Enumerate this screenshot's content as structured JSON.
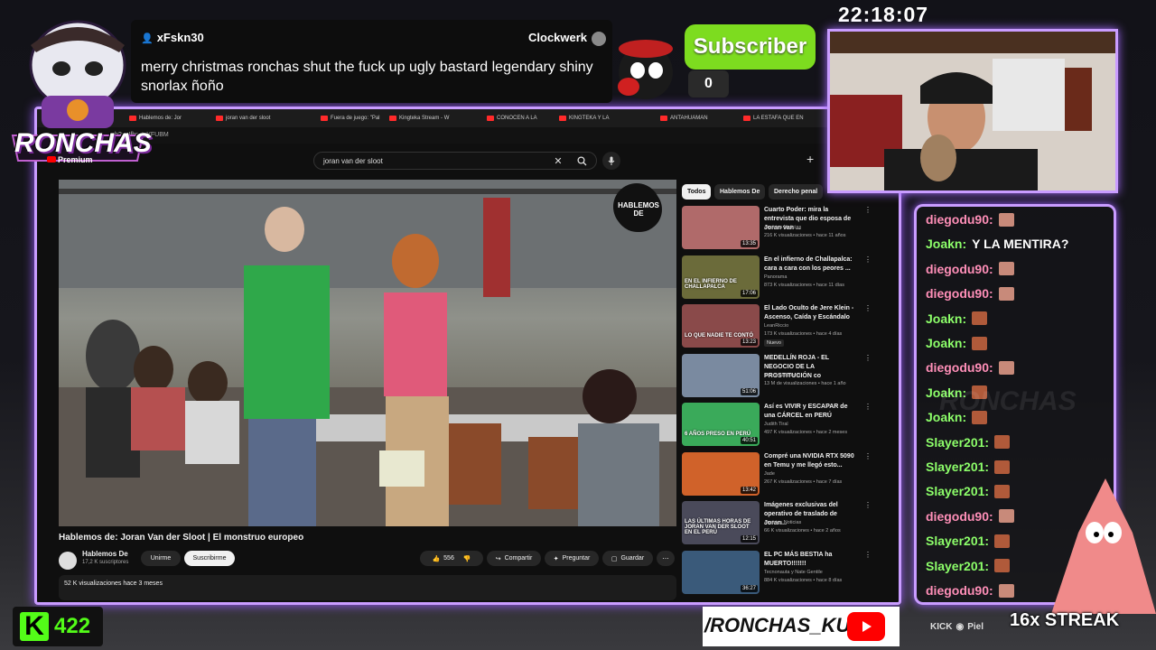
{
  "overlay": {
    "clock": "22:18:07",
    "chat_highlight": {
      "username": "xFskn30",
      "badge_name": "Clockwerk",
      "message": "merry christmas ronchas shut the fuck up ugly bastard legendary shiny snorlax ñoño"
    },
    "logo_text": "RONCHAS",
    "premium_label": "Premium",
    "subscriber": {
      "label": "Subscriber",
      "count": "0"
    },
    "kick_count": "422",
    "handle": "/RONCHAS_KUN",
    "social_text": "KICK",
    "social_extra": "Piel",
    "streak": "16x STREAK",
    "watermark": "RONCHAS",
    "accent": "#c99cff",
    "kick_green": "#53fc18"
  },
  "browser": {
    "tabs": [
      "Hablemos de: Jor",
      "joran van der sloot",
      "Fuera de juego: \"Pal",
      "Kingteka Stream - W",
      "CONOCEN A LA",
      "KINGTEKA Y LA",
      "ANTAHUAMAN",
      "LA ESTAFA QUE EN"
    ],
    "url": "h?v=Ifbm0-YFUBM"
  },
  "youtube": {
    "search_value": "joran van der sloot",
    "player_logo": "HABLEMOS DE",
    "video_title": "Hablemos de: Joran Van der Sloot | El monstruo europeo",
    "channel_name": "Hablemos De",
    "channel_subs": "17,2 K suscriptores",
    "join_label": "Unirme",
    "subscribe_label": "Suscribirme",
    "likes": "556",
    "share_label": "Compartir",
    "ask_label": "Preguntar",
    "save_label": "Guardar",
    "views_line": "52 K visualizaciones  hace 3 meses",
    "chips": [
      "Todos",
      "Hablemos De",
      "Derecho penal"
    ],
    "recommendations": [
      {
        "title": "Cuarto Poder: mira la entrevista que dio esposa de Joran van ...",
        "channel": "América Noticias",
        "meta": "216 K visualizaciones • hace 11 años",
        "duration": "13:35",
        "color": "#b06a6a"
      },
      {
        "title": "En el infierno de Challapalca: cara a cara con los peores ...",
        "channel": "Panorama",
        "meta": "873 K visualizaciones • hace 11 días",
        "duration": "17:06",
        "color": "#6b6b3a",
        "thumb_text": "EN EL INFIERNO DE CHALLAPALCA"
      },
      {
        "title": "El Lado Oculto de Jere Klein - Ascenso, Caída y Escándalo",
        "channel": "LeanRiccio",
        "meta": "173 K visualizaciones • hace 4 días",
        "duration": "13:23",
        "badge": "Nuevo",
        "color": "#8a4a4a",
        "thumb_text": "LO QUE NADIE TE CONTÓ"
      },
      {
        "title": "MEDELLÍN ROJA - EL NEGOCIO DE LA PROSTITUCIÓN co",
        "channel": "Zazza el Italiano",
        "meta": "13 M de visualizaciones • hace 1 año",
        "duration": "51:06",
        "color": "#7a8aa0"
      },
      {
        "title": "Así es VIVIR y ESCAPAR de una CÁRCEL en PERÚ",
        "channel": "Judith Tiral",
        "meta": "497 K visualizaciones • hace 2 meses",
        "duration": "40:51",
        "color": "#3aaa5a",
        "thumb_text": "6 AÑOS PRESO EN PERÚ"
      },
      {
        "title": "Compré una NVIDIA RTX 5090 en Temu y me llegó esto...",
        "channel": "Jade",
        "meta": "267 K visualizaciones • hace 7 días",
        "duration": "13:42",
        "color": "#d0622a"
      },
      {
        "title": "Imágenes exclusivas del operativo de traslado de Joran...",
        "channel": "América Noticias",
        "meta": "66 K visualizaciones • hace 2 años",
        "duration": "12:15",
        "color": "#4a4a5a",
        "thumb_text": "LAS ÚLTIMAS HORAS DE JORAN VAN DER SLOOT EN EL PERÚ"
      },
      {
        "title": "EL PC MÁS BESTIA ha MUERTO!!!!!!!",
        "channel": "Tecnonauta y Nate Gentile",
        "meta": "884 K visualizaciones • hace 8 días",
        "duration": "36:27",
        "color": "#3a5a7a"
      }
    ]
  },
  "chat": {
    "messages": [
      {
        "user": "diegodu90:",
        "text": "",
        "emote": "#c88a7a",
        "color": "#ff8fb8"
      },
      {
        "user": "Joakn:",
        "text": "Y LA MENTIRA?",
        "emote": "",
        "color": "#8dff6a"
      },
      {
        "user": "diegodu90:",
        "text": "",
        "emote": "#c88a7a",
        "color": "#ff8fb8"
      },
      {
        "user": "diegodu90:",
        "text": "",
        "emote": "#c88a7a",
        "color": "#ff8fb8"
      },
      {
        "user": "Joakn:",
        "text": "",
        "emote": "#b05a3a",
        "color": "#8dff6a"
      },
      {
        "user": "Joakn:",
        "text": "",
        "emote": "#b05a3a",
        "color": "#8dff6a"
      },
      {
        "user": "diegodu90:",
        "text": "",
        "emote": "#c88a7a",
        "color": "#ff8fb8"
      },
      {
        "user": "Joakn:",
        "text": "",
        "emote": "#b05a3a",
        "color": "#8dff6a"
      },
      {
        "user": "Joakn:",
        "text": "",
        "emote": "#b05a3a",
        "color": "#8dff6a"
      },
      {
        "user": "Slayer201:",
        "text": "",
        "emote": "#b05a3a",
        "color": "#8dff6a"
      },
      {
        "user": "Slayer201:",
        "text": "",
        "emote": "#b05a3a",
        "color": "#8dff6a"
      },
      {
        "user": "Slayer201:",
        "text": "",
        "emote": "#b05a3a",
        "color": "#8dff6a"
      },
      {
        "user": "diegodu90:",
        "text": "",
        "emote": "#c88a7a",
        "color": "#ff8fb8"
      },
      {
        "user": "Slayer201:",
        "text": "",
        "emote": "#b05a3a",
        "color": "#8dff6a"
      },
      {
        "user": "Slayer201:",
        "text": "",
        "emote": "#b05a3a",
        "color": "#8dff6a"
      },
      {
        "user": "diegodu90:",
        "text": "",
        "emote": "#c88a7a",
        "color": "#ff8fb8"
      }
    ]
  }
}
